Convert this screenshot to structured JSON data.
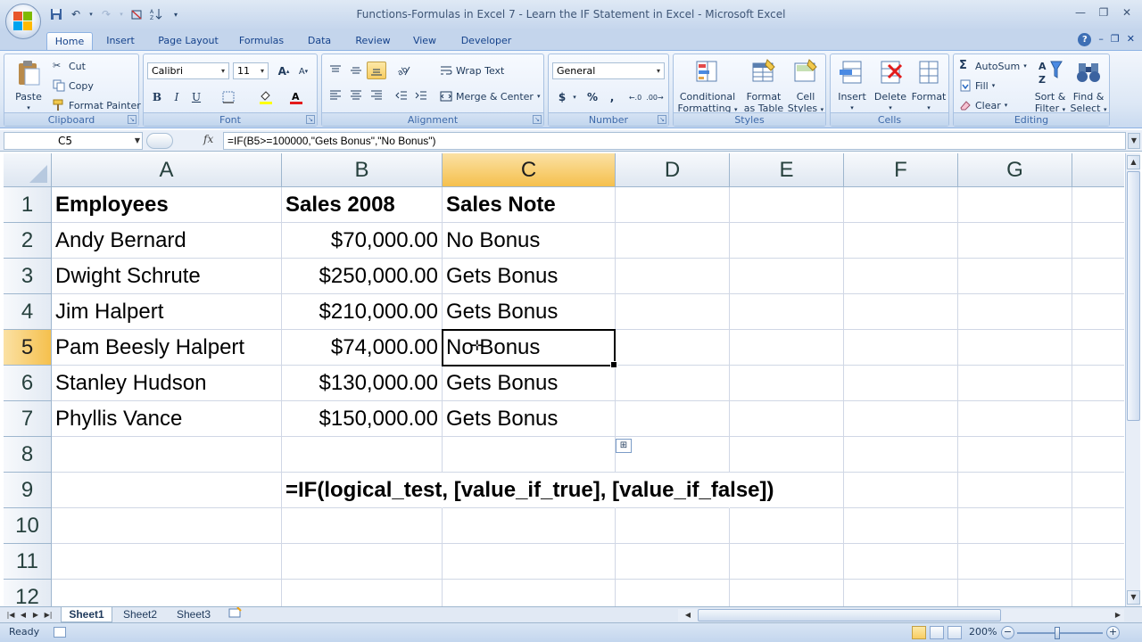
{
  "window": {
    "title": "Functions-Formulas in Excel 7 - Learn the IF Statement in Excel - Microsoft Excel"
  },
  "ribbon": {
    "tabs": [
      "Home",
      "Insert",
      "Page Layout",
      "Formulas",
      "Data",
      "Review",
      "View",
      "Developer"
    ],
    "active_tab": "Home",
    "clipboard": {
      "label": "Clipboard",
      "paste": "Paste",
      "cut": "Cut",
      "copy": "Copy",
      "format_painter": "Format Painter"
    },
    "font": {
      "label": "Font",
      "name": "Calibri",
      "size": "11",
      "bold": "B",
      "italic": "I",
      "underline": "U"
    },
    "alignment": {
      "label": "Alignment",
      "wrap_text": "Wrap Text",
      "merge_center": "Merge & Center"
    },
    "number": {
      "label": "Number",
      "format": "General",
      "currency": "$",
      "percent": "%",
      "comma": ","
    },
    "styles": {
      "label": "Styles",
      "conditional_1": "Conditional",
      "conditional_2": "Formatting",
      "format_table_1": "Format",
      "format_table_2": "as Table",
      "cell_styles_1": "Cell",
      "cell_styles_2": "Styles"
    },
    "cells": {
      "label": "Cells",
      "insert": "Insert",
      "delete": "Delete",
      "format": "Format"
    },
    "editing": {
      "label": "Editing",
      "autosum": "AutoSum",
      "fill": "Fill",
      "clear": "Clear",
      "sort_1": "Sort &",
      "sort_2": "Filter",
      "find_1": "Find &",
      "find_2": "Select"
    }
  },
  "formula_bar": {
    "name_box": "C5",
    "fx": "fx",
    "formula": "=IF(B5>=100000,\"Gets Bonus\",\"No Bonus\")"
  },
  "sheet": {
    "columns": [
      "A",
      "B",
      "C",
      "D",
      "E",
      "F",
      "G"
    ],
    "selected_column": "C",
    "rows": [
      "1",
      "2",
      "3",
      "4",
      "5",
      "6",
      "7",
      "8",
      "9",
      "10",
      "11",
      "12"
    ],
    "selected_row": "5",
    "header": {
      "a": "Employees",
      "b": "Sales 2008",
      "c": "Sales Note"
    },
    "data": [
      {
        "name": "Andy Bernard",
        "sales": "$70,000.00",
        "note": "No Bonus"
      },
      {
        "name": "Dwight Schrute",
        "sales": "$250,000.00",
        "note": "Gets Bonus"
      },
      {
        "name": "Jim Halpert",
        "sales": "$210,000.00",
        "note": "Gets Bonus"
      },
      {
        "name": "Pam Beesly Halpert",
        "sales": "$74,000.00",
        "note": "No Bonus"
      },
      {
        "name": "Stanley Hudson",
        "sales": "$130,000.00",
        "note": "Gets Bonus"
      },
      {
        "name": "Phyllis Vance",
        "sales": "$150,000.00",
        "note": "Gets Bonus"
      }
    ],
    "syntax_note": "=IF(logical_test, [value_if_true], [value_if_false])",
    "active_cell": "C5"
  },
  "sheet_tabs": [
    "Sheet1",
    "Sheet2",
    "Sheet3"
  ],
  "active_sheet": "Sheet1",
  "status": {
    "text": "Ready",
    "zoom": "200%",
    "zoom_minus": "−",
    "zoom_plus": "+"
  },
  "icons": {
    "office_button": "office-logo-icon",
    "save": "save-icon",
    "undo": "undo-icon",
    "redo": "redo-icon"
  }
}
